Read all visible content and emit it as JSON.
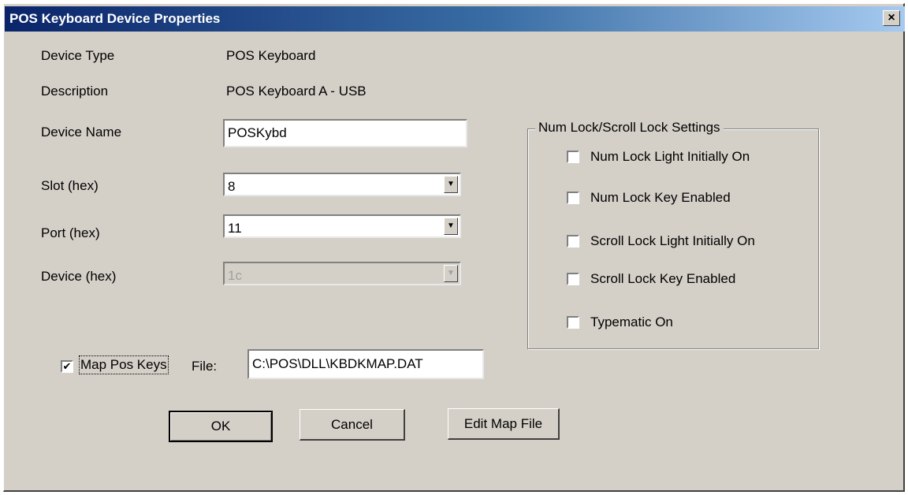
{
  "window": {
    "title": "POS Keyboard Device Properties",
    "close_label": "×"
  },
  "info": {
    "device_type_label": "Device Type",
    "device_type_value": "POS Keyboard",
    "description_label": "Description",
    "description_value": "POS Keyboard A - USB"
  },
  "fields": {
    "device_name_label": "Device Name",
    "device_name_value": "POSKybd",
    "slot_label": "Slot (hex)",
    "slot_value": "8",
    "port_label": "Port (hex)",
    "port_value": "11",
    "device_label": "Device (hex)",
    "device_value": "1c",
    "dropdown_arrow": "▼"
  },
  "mapping": {
    "checkbox_checked": true,
    "check_glyph": "✔",
    "checkbox_label": "Map Pos Keys",
    "file_label": "File:",
    "file_value": "C:\\POS\\DLL\\KBDKMAP.DAT"
  },
  "lock_settings": {
    "title": "Num Lock/Scroll Lock Settings",
    "options": [
      {
        "label": "Num Lock Light Initially On",
        "checked": false
      },
      {
        "label": "Num Lock Key Enabled",
        "checked": false
      },
      {
        "label": "Scroll Lock Light Initially On",
        "checked": false
      },
      {
        "label": "Scroll Lock Key Enabled",
        "checked": false
      },
      {
        "label": "Typematic On",
        "checked": false
      }
    ]
  },
  "buttons": {
    "ok": "OK",
    "cancel": "Cancel",
    "edit_map": "Edit Map File"
  }
}
